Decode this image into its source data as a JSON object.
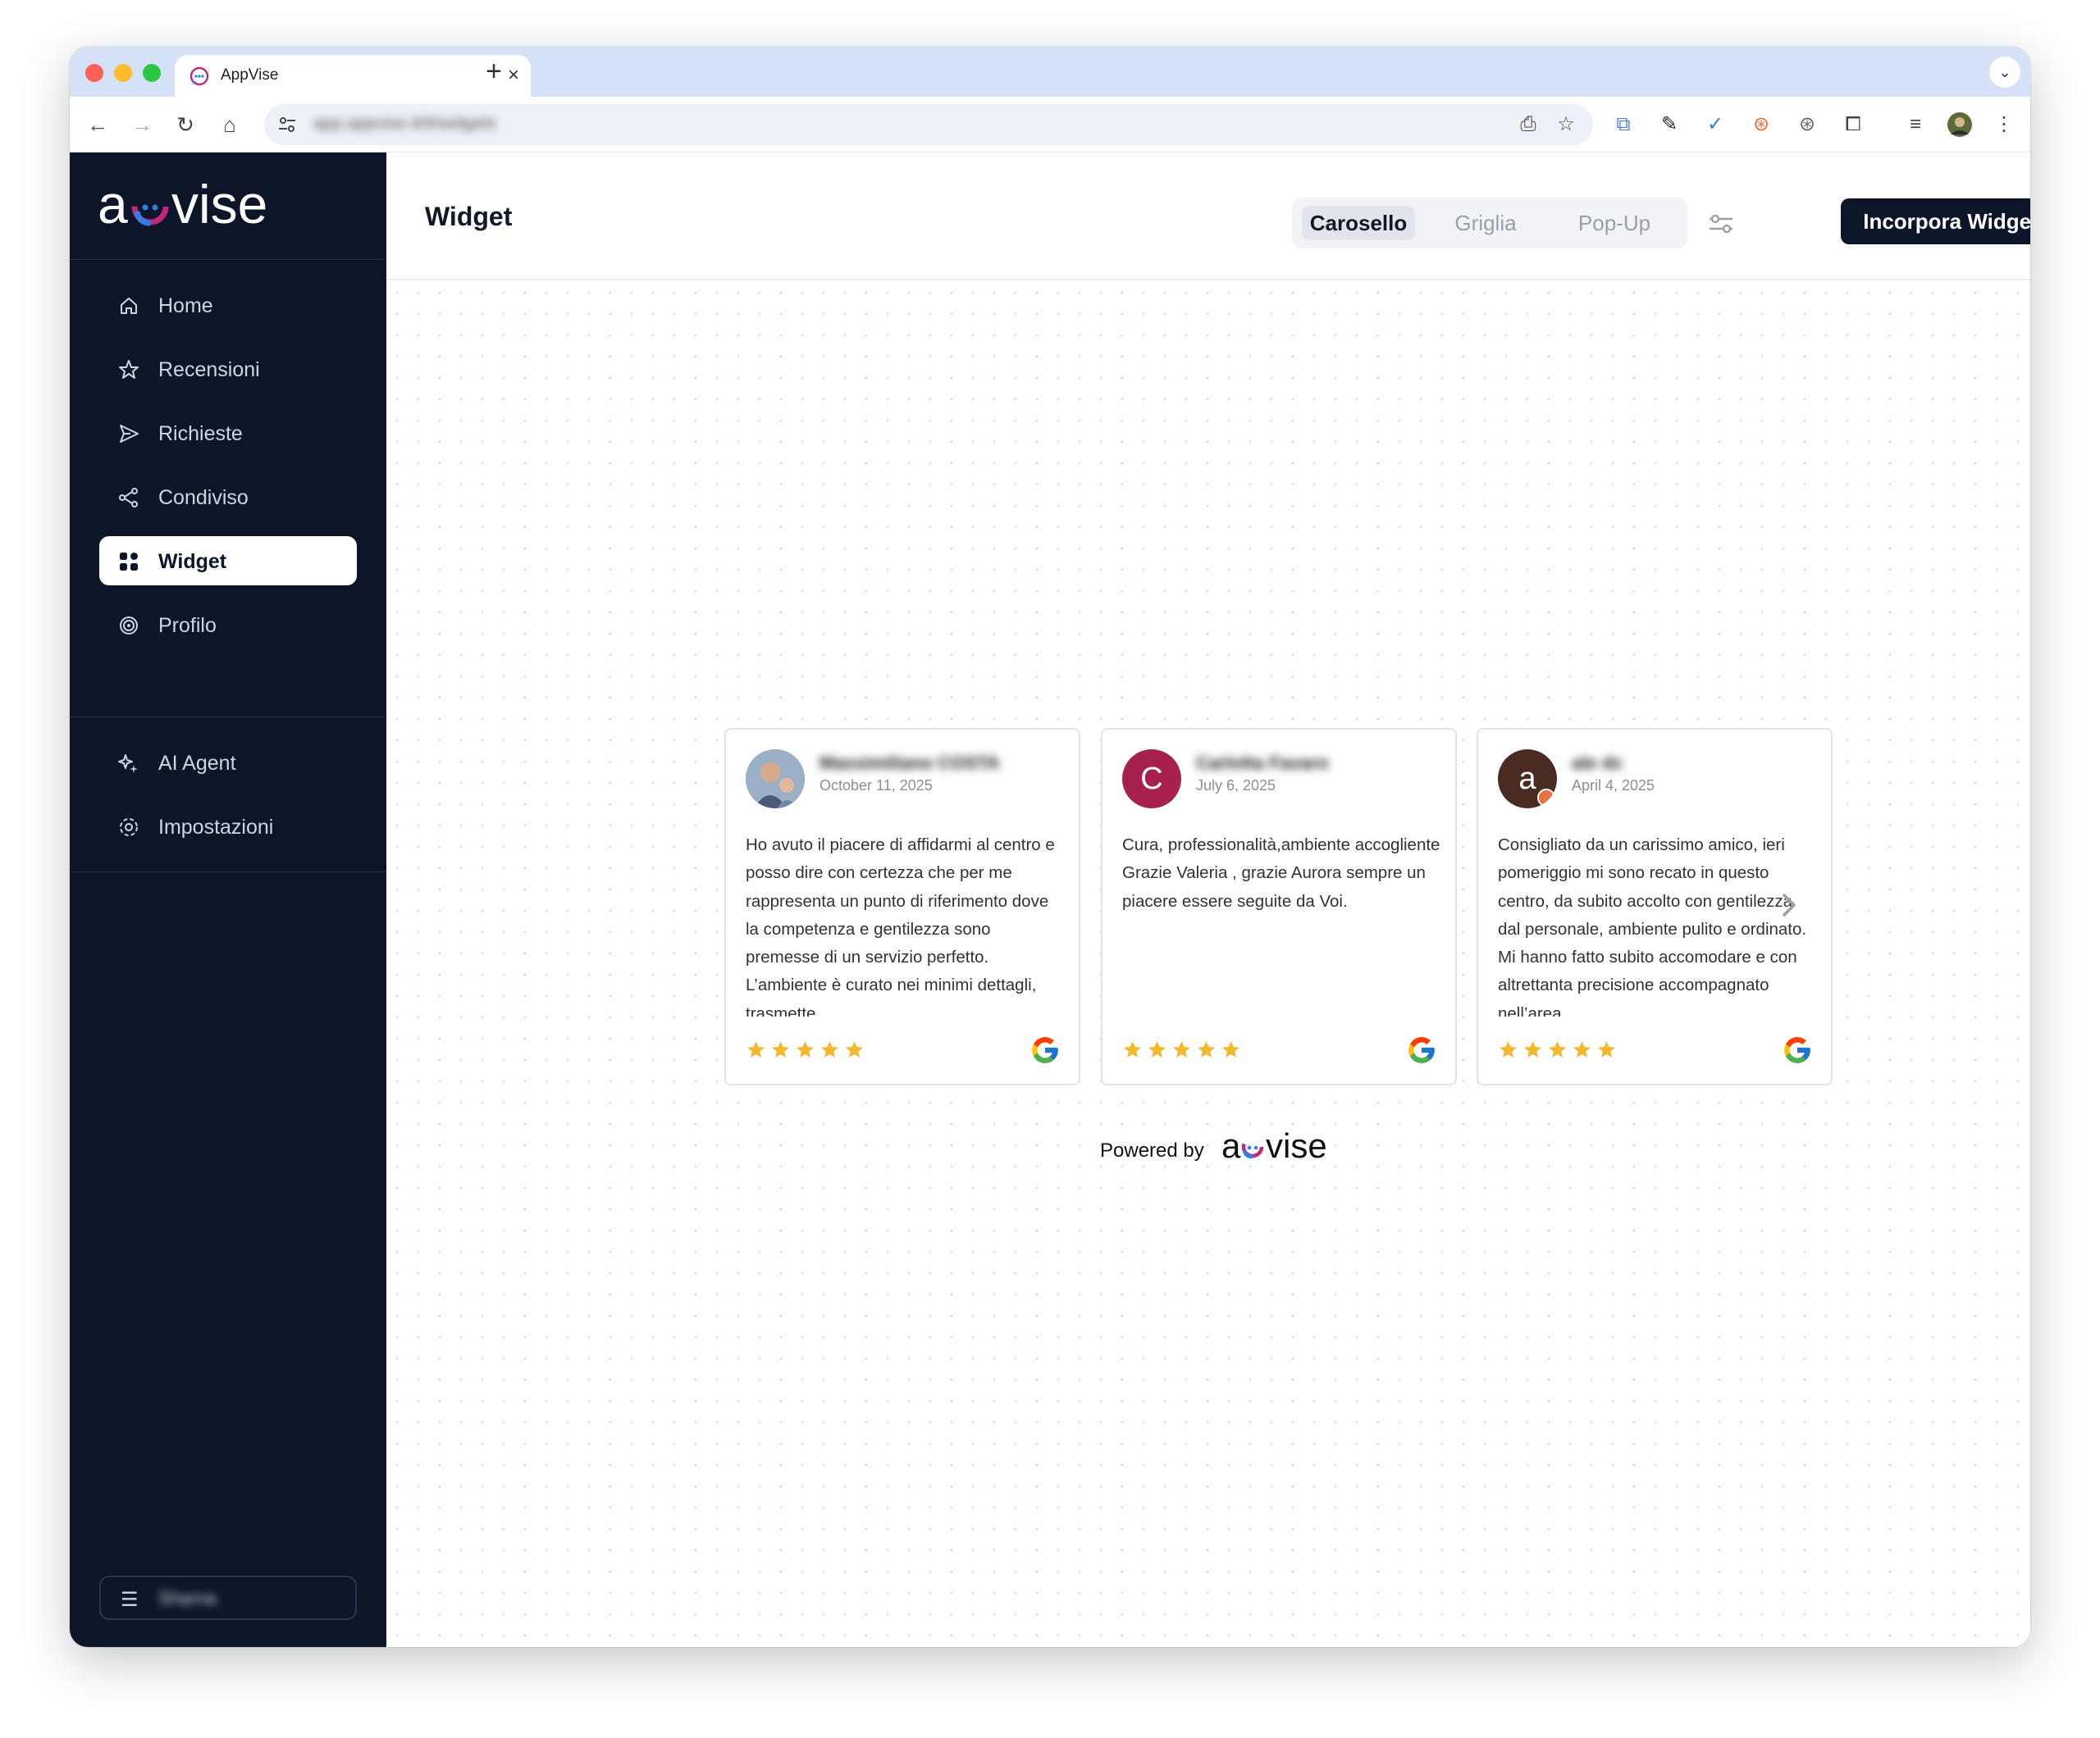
{
  "browser": {
    "tab_title": "AppVise",
    "tab_close": "×",
    "new_tab": "+",
    "url": "app.appvise.it/it/widgets"
  },
  "brand": {
    "logo": "acvise",
    "accent_pink": "#c0267a",
    "accent_blue": "#2f7fe6"
  },
  "sidebar": {
    "items": [
      {
        "label": "Home",
        "icon": "home-icon"
      },
      {
        "label": "Recensioni",
        "icon": "star-icon"
      },
      {
        "label": "Richieste",
        "icon": "send-icon"
      },
      {
        "label": "Condiviso",
        "icon": "share-icon"
      },
      {
        "label": "Widget",
        "icon": "grid-icon",
        "active": true
      },
      {
        "label": "Profilo",
        "icon": "target-icon"
      }
    ],
    "secondary_items": [
      {
        "label": "AI Agent",
        "icon": "sparkle-icon"
      },
      {
        "label": "Impostazioni",
        "icon": "gear-icon"
      }
    ],
    "user": {
      "name": "Sharna"
    }
  },
  "header": {
    "title": "Widget",
    "tabs": [
      {
        "label": "Carosello",
        "active": true
      },
      {
        "label": "Griglia"
      },
      {
        "label": "Pop-Up"
      }
    ],
    "embed_label": "Incorpora Widget"
  },
  "reviews": [
    {
      "name": "Massimiliano COSTA",
      "date": "October 11, 2025",
      "text": "Ho avuto il piacere di affidarmi al centro e posso dire con certezza che per me rappresenta un punto di riferimento dove la competenza e gentilezza sono premesse di un servizio perfetto. L’ambiente è curato nei minimi dettagli, trasmette",
      "rating": 5,
      "avatar_type": "photo"
    },
    {
      "name": "Carlotta Favaro",
      "date": "July 6, 2025",
      "text": "Cura, professionalità,ambiente accogliente Grazie Valeria , grazie Aurora sempre un piacere essere seguite da Voi.",
      "rating": 5,
      "avatar_letter": "C",
      "avatar_color": "#a8204d"
    },
    {
      "name": "ale dc",
      "date": "April 4, 2025",
      "text": "Consigliato da un carissimo amico, ieri pomeriggio mi sono recato in questo centro, da subito accolto con gentilezza dal personale, ambiente pulito e ordinato. Mi hanno fatto subito accomodare e con altrettanta precisione accompagnato nell’area",
      "rating": 5,
      "avatar_letter": "a",
      "avatar_color": "#4a2b22"
    }
  ],
  "powered_by": "Powered by",
  "star_color": "#f4b82e"
}
